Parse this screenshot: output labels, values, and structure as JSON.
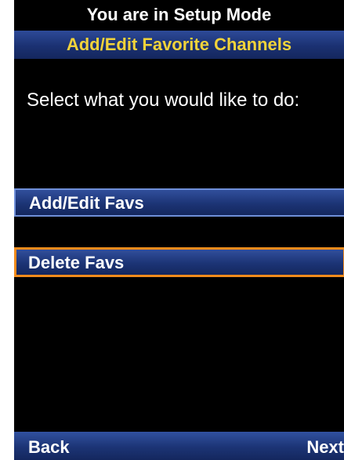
{
  "status": {
    "mode_text": "You are in Setup Mode"
  },
  "header": {
    "title": "Add/Edit Favorite Channels"
  },
  "main": {
    "prompt": "Select what you would like to do:",
    "options": [
      {
        "label": "Add/Edit Favs",
        "selected": false
      },
      {
        "label": "Delete Favs",
        "selected": true
      }
    ]
  },
  "softkeys": {
    "left": "Back",
    "right": "Next"
  },
  "colors": {
    "title_text": "#f2d33a",
    "bar_blue": "#1c3475",
    "selection_outline": "#f28b1c",
    "screen_background": "#000000"
  }
}
